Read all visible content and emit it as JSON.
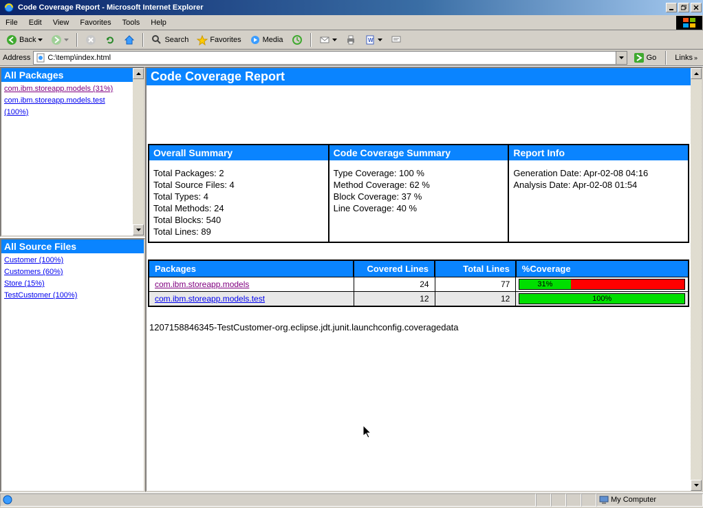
{
  "window": {
    "title": "Code Coverage Report - Microsoft Internet Explorer"
  },
  "menu": {
    "file": "File",
    "edit": "Edit",
    "view": "View",
    "favorites": "Favorites",
    "tools": "Tools",
    "help": "Help"
  },
  "toolbar": {
    "back": "Back",
    "search": "Search",
    "favorites": "Favorites",
    "media": "Media"
  },
  "address": {
    "label": "Address",
    "value": "C:\\temp\\index.html",
    "go": "Go",
    "links": "Links"
  },
  "sidebar": {
    "packages_header": "All Packages",
    "packages": [
      {
        "label": "com.ibm.storeapp.models  (31%)",
        "visited": true
      },
      {
        "label": "com.ibm.storeapp.models.test  (100%)",
        "visited": false
      }
    ],
    "files_header": "All Source Files",
    "files": [
      {
        "label": "Customer  (100%)"
      },
      {
        "label": "Customers  (60%)"
      },
      {
        "label": "Store  (15%)"
      },
      {
        "label": "TestCustomer  (100%)"
      }
    ]
  },
  "report": {
    "title": "Code Coverage Report",
    "overall_header": "Overall Summary",
    "overall": {
      "l1": "Total Packages: 2",
      "l2": "Total Source Files: 4",
      "l3": "Total Types: 4",
      "l4": "Total Methods: 24",
      "l5": "Total Blocks: 540",
      "l6": "Total Lines: 89"
    },
    "coverage_header": "Code Coverage Summary",
    "coverage": {
      "l1": "Type Coverage: 100 %",
      "l2": "Method Coverage: 62 %",
      "l3": "Block Coverage: 37 %",
      "l4": "Line Coverage: 40 %"
    },
    "info_header": "Report Info",
    "info": {
      "l1": "Generation Date: Apr-02-08 04:16",
      "l2": "Analysis Date: Apr-02-08 01:54"
    },
    "table": {
      "h1": "Packages",
      "h2": "Covered Lines",
      "h3": "Total Lines",
      "h4": "%Coverage",
      "rows": [
        {
          "name": "com.ibm.storeapp.models",
          "covered": "24",
          "total": "77",
          "pct": "31%",
          "pctnum": 31,
          "visited": true
        },
        {
          "name": "com.ibm.storeapp.models.test",
          "covered": "12",
          "total": "12",
          "pct": "100%",
          "pctnum": 100,
          "visited": false
        }
      ]
    },
    "footer": "1207158846345-TestCustomer-org.eclipse.jdt.junit.launchconfig.coveragedata"
  },
  "status": {
    "zone": "My Computer"
  }
}
